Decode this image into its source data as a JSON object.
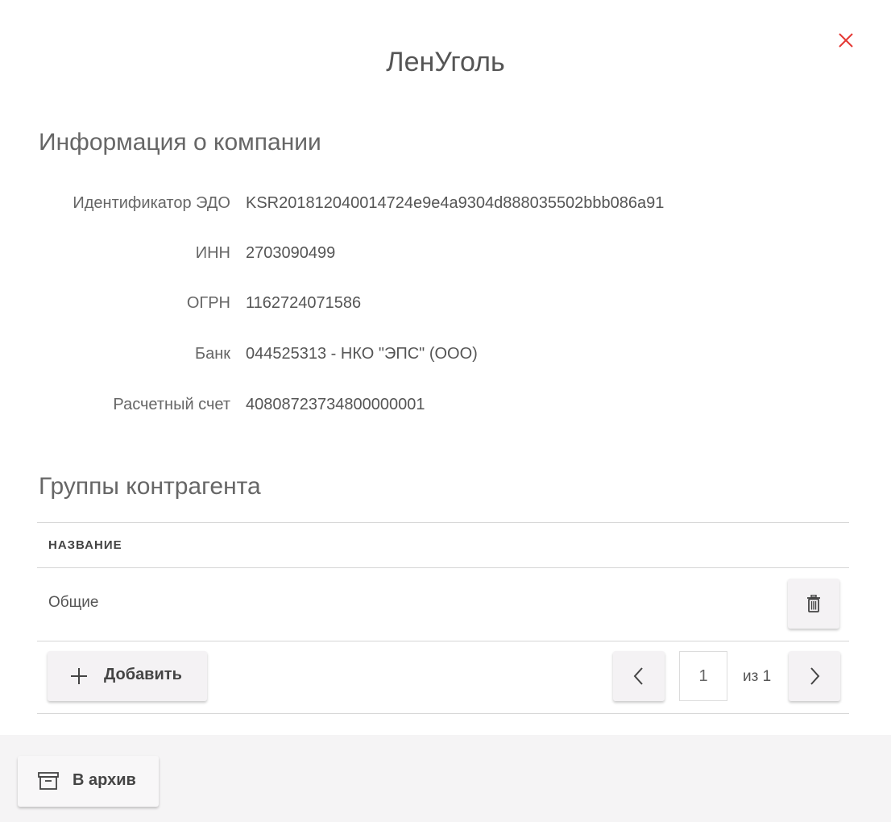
{
  "dialog": {
    "title": "ЛенУголь",
    "accent_color": "#e53935"
  },
  "company_info": {
    "heading": "Информация о компании",
    "fields": [
      {
        "label": "Идентификатор ЭДО",
        "value": "KSR201812040014724e9e4a9304d888035502bbb086a91"
      },
      {
        "label": "ИНН",
        "value": "2703090499"
      },
      {
        "label": "ОГРН",
        "value": "1162724071586"
      },
      {
        "label": "Банк",
        "value": "044525313 - НКО \"ЭПС\" (ООО)"
      },
      {
        "label": "Расчетный счет",
        "value": "40808723734800000001"
      }
    ]
  },
  "groups": {
    "heading": "Группы контрагента",
    "table": {
      "columns": [
        "НАЗВАНИЕ"
      ],
      "rows": [
        {
          "name": "Общие",
          "action_icon": "trash-icon"
        }
      ]
    },
    "add_label": "Добавить",
    "pagination": {
      "current_page": "1",
      "of_text": "из 1"
    }
  },
  "footer": {
    "archive_label": "В архив"
  },
  "icons": {
    "close": "close-icon",
    "delete": "trash-icon",
    "add": "plus-icon",
    "prev": "chevron-left-icon",
    "next": "chevron-right-icon",
    "archive": "archive-icon"
  }
}
